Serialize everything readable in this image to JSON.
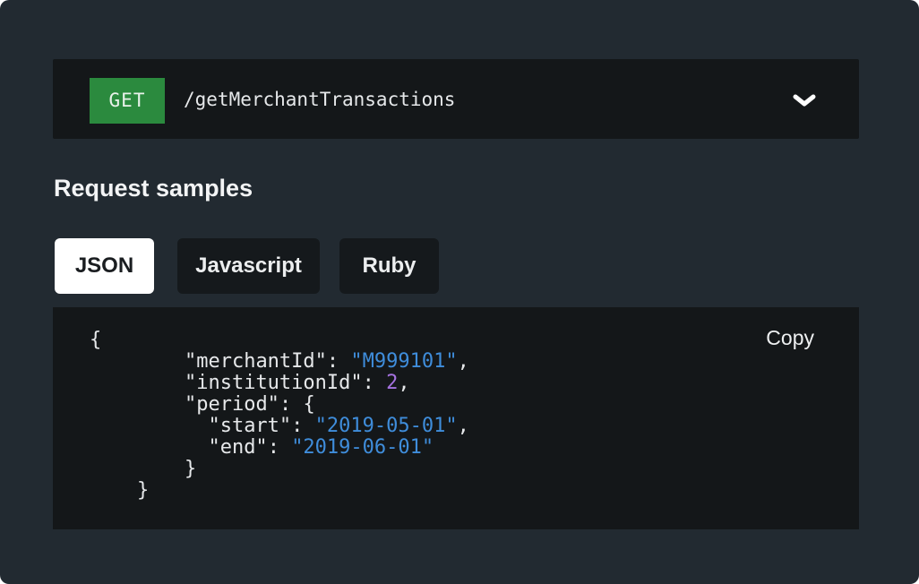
{
  "endpoint": {
    "method": "GET",
    "path": "/getMerchantTransactions",
    "toggle_icon": "chevron-down-icon"
  },
  "section": {
    "title": "Request samples"
  },
  "tabs": [
    {
      "label": "JSON",
      "active": true
    },
    {
      "label": "Javascript",
      "active": false
    },
    {
      "label": "Ruby",
      "active": false
    }
  ],
  "code": {
    "copy_label": "Copy",
    "open_brace": "{",
    "close_brace": "}",
    "merchant_key": "\"merchantId\"",
    "merchant_value": "\"M999101\"",
    "institution_key": "\"institutionId\"",
    "institution_value": "2",
    "period_key": "\"period\"",
    "start_key": "\"start\"",
    "start_value": "\"2019-05-01\"",
    "end_key": "\"end\"",
    "end_value": "\"2019-06-01\""
  },
  "colors": {
    "method_badge": "#2b8a3e",
    "string": "#3f8ddb",
    "number": "#a572e0",
    "panel_bg": "#222a31",
    "code_bg": "#141719"
  }
}
